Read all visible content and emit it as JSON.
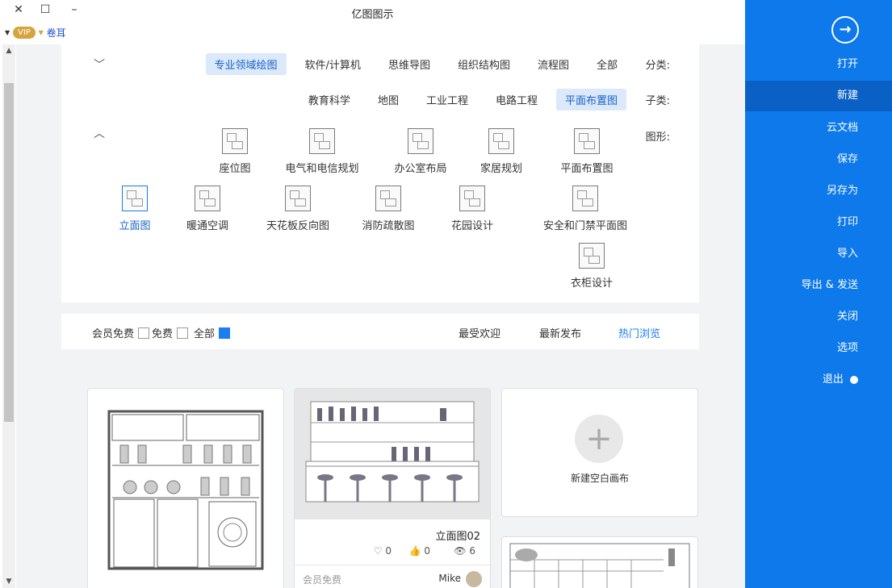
{
  "window": {
    "title": "亿图图示",
    "minimize": "–",
    "maximize": "☐",
    "close": "✕"
  },
  "user": {
    "vip": "VIP",
    "name": "卷耳"
  },
  "categories": {
    "label": "分类:",
    "items": [
      "全部",
      "流程图",
      "组织结构图",
      "思维导图",
      "软件/计算机",
      "专业领域绘图"
    ],
    "active": "专业领域绘图"
  },
  "subcategories": {
    "label": "子类:",
    "items": [
      "平面布置图",
      "电路工程",
      "工业工程",
      "地图",
      "教育科学"
    ],
    "active": "平面布置图"
  },
  "shapes": {
    "label": "图形:",
    "items": [
      "平面布置图",
      "家居规划",
      "办公室布局",
      "电气和电信规划",
      "座位图",
      "安全和门禁平面图",
      "花园设计",
      "消防疏散图",
      "天花板反向图",
      "暖通空调",
      "立面图",
      "衣柜设计"
    ],
    "active": "立面图"
  },
  "sort": {
    "items": [
      "热门浏览",
      "最新发布",
      "最受欢迎"
    ],
    "active": "热门浏览"
  },
  "price_filter": {
    "items": [
      "全部",
      "免费",
      "会员免费"
    ],
    "checked": "全部"
  },
  "cards": {
    "template1": {
      "title": "立面图02",
      "views": "6",
      "likes": "0",
      "favs": "0",
      "author": "Mike",
      "tag": "会员免费"
    },
    "new_blank": "新建空白画布"
  },
  "sidebar": {
    "back_icon": "arrow-right-circle",
    "items": [
      "打开",
      "新建",
      "云文档",
      "保存",
      "另存为",
      "打印",
      "导入",
      "导出 & 发送",
      "关闭",
      "选项",
      "退出"
    ],
    "active": "新建"
  }
}
